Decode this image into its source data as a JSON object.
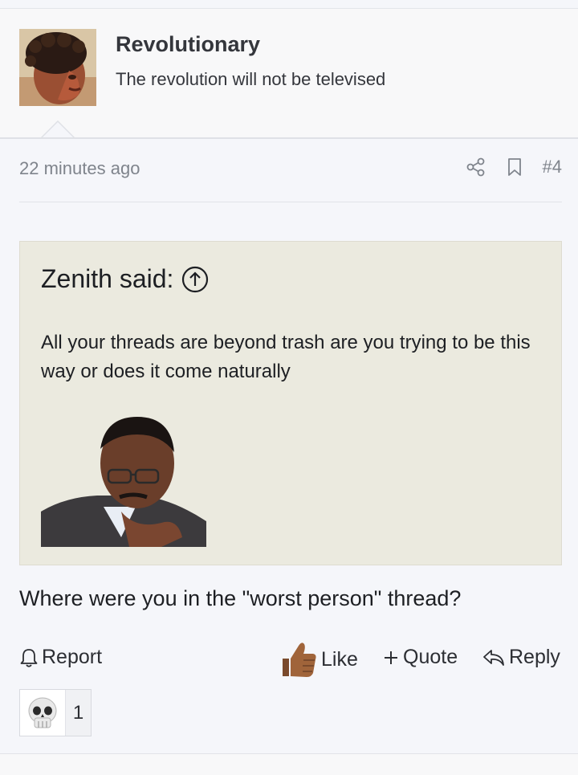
{
  "user": {
    "name": "Revolutionary",
    "title": "The revolution will not be televised"
  },
  "meta": {
    "time": "22 minutes ago",
    "post_number": "#4"
  },
  "quote": {
    "author": "Zenith said:",
    "text": "All your threads are beyond trash are you trying to be this way or does it come naturally"
  },
  "post": {
    "body": "Where were you in the \"worst person\" thread?"
  },
  "actions": {
    "report": "Report",
    "like": "Like",
    "quote": "Quote",
    "reply": "Reply"
  },
  "reactions": {
    "count": "1"
  },
  "icons": [
    "share-icon",
    "bookmark-icon",
    "circle-up-arrow-icon",
    "bell-icon",
    "thumbs-up-icon",
    "plus-icon",
    "reply-arrow-icon",
    "skull-emoji-icon"
  ]
}
